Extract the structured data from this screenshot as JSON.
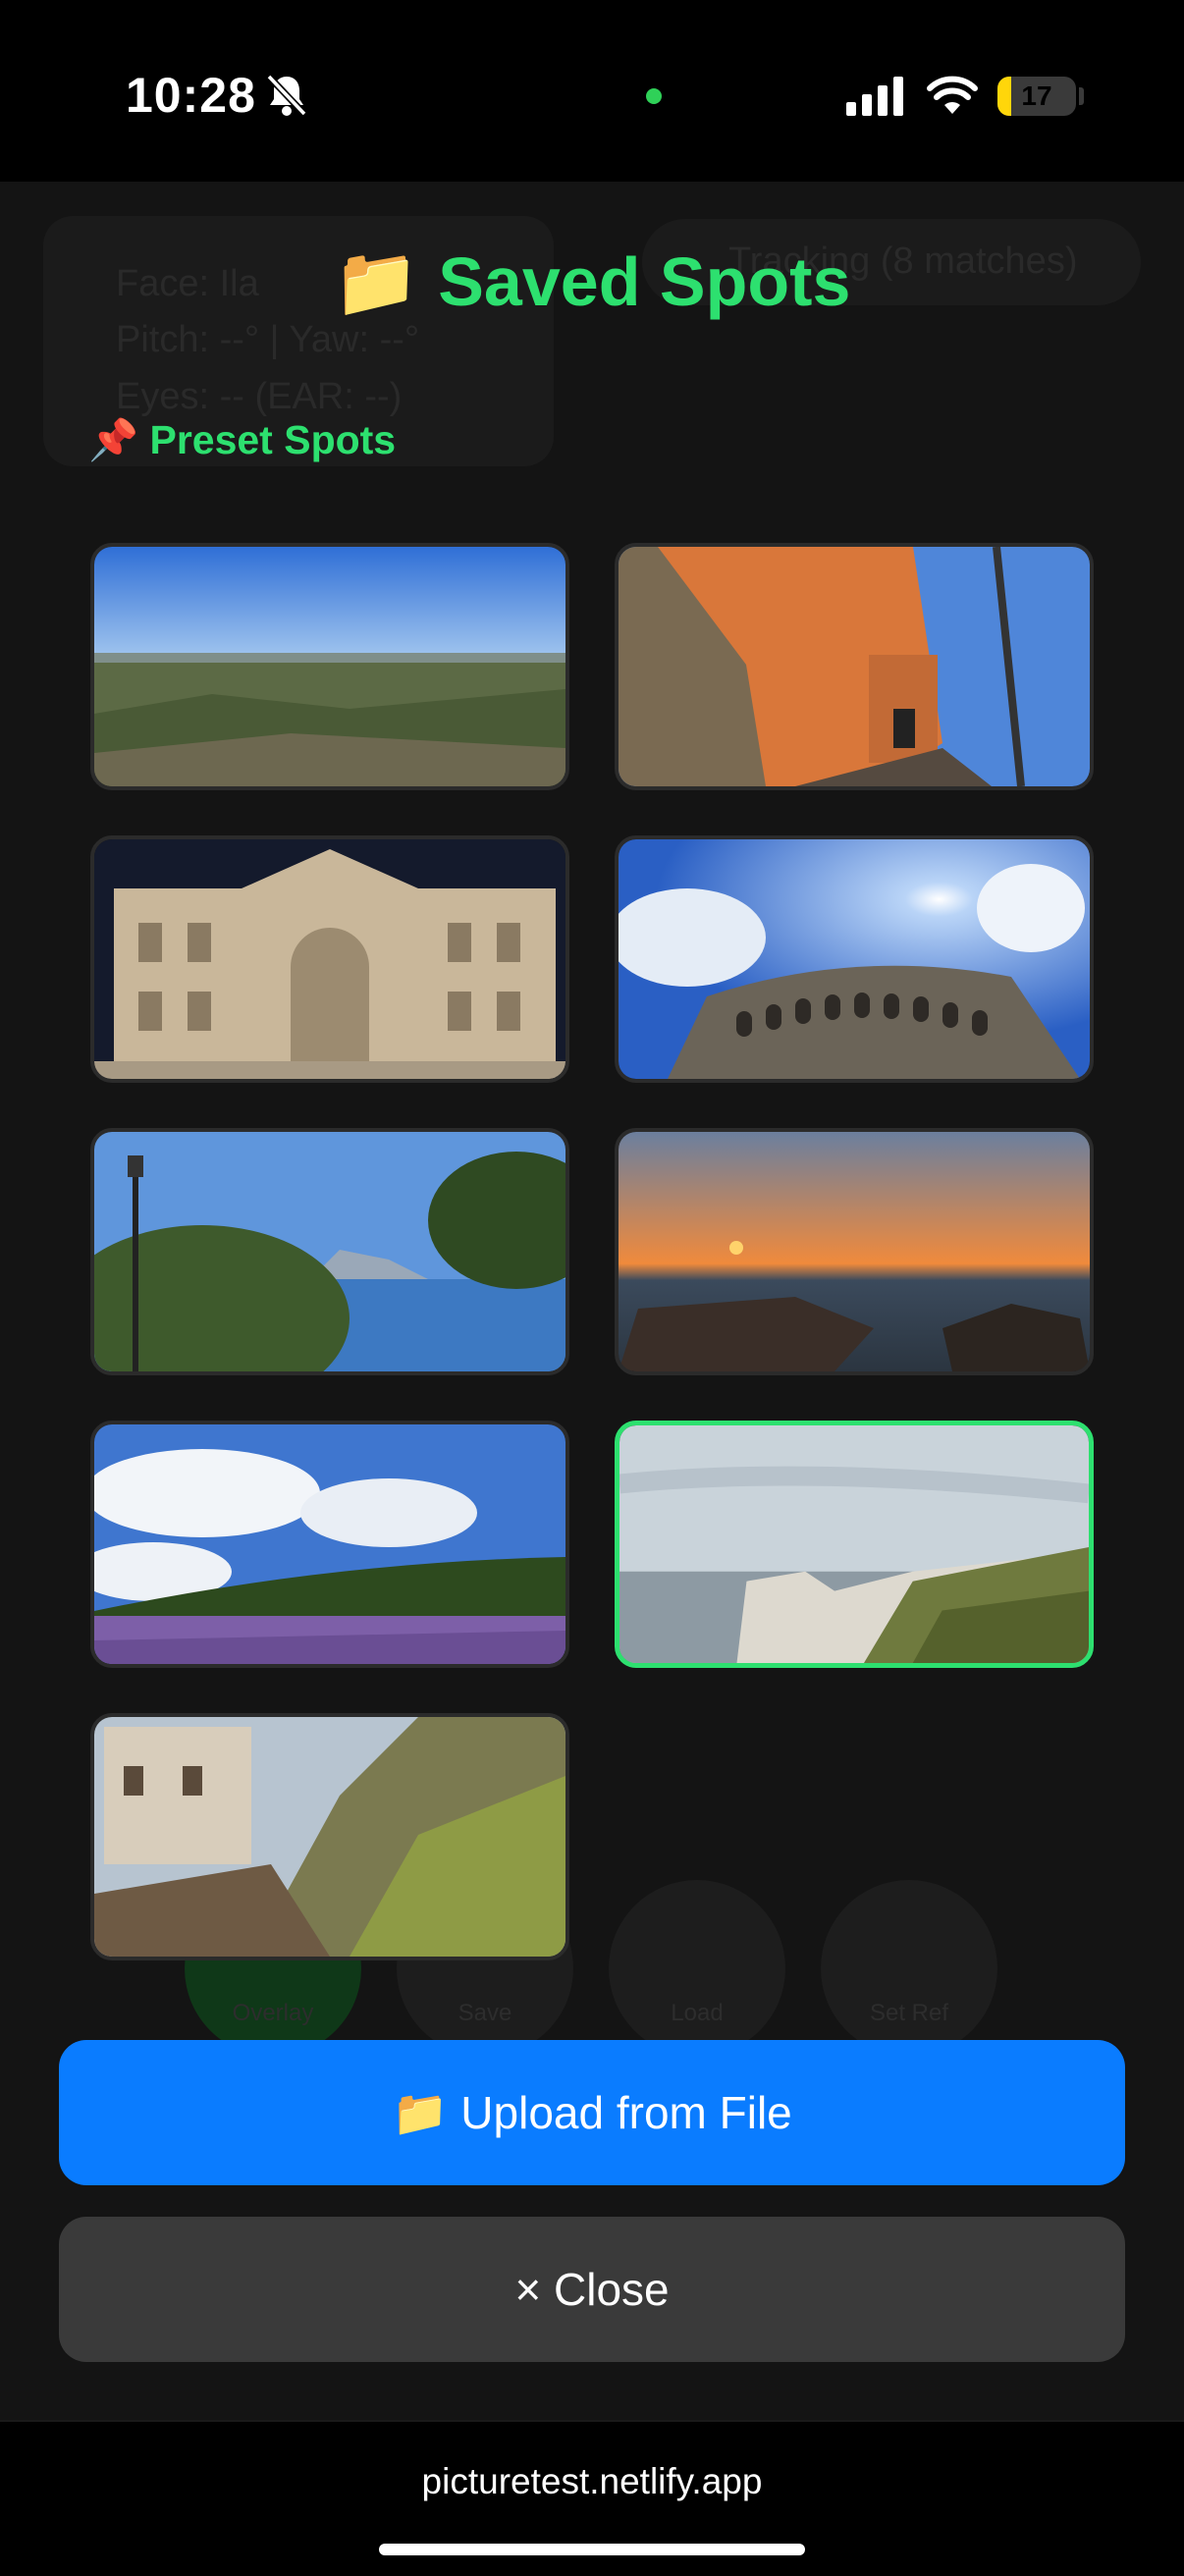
{
  "status_bar": {
    "time": "10:28",
    "battery_percent": 17,
    "icons": [
      "bell-slash-icon",
      "camera-in-use-dot",
      "cellular-signal-icon",
      "wifi-icon",
      "battery-icon"
    ]
  },
  "background_app": {
    "panel_lines": [
      "Face: Ila",
      "Pitch: --° | Yaw: --°",
      "Eyes: -- (EAR: --)"
    ],
    "tracking_pill": "Tracking (8 matches)",
    "buttons": [
      "Overlay",
      "Save",
      "Load",
      "Set Ref"
    ]
  },
  "modal": {
    "title_emoji": "📁",
    "title": "Saved Spots",
    "section_emoji": "📌",
    "section_label": "Preset Spots",
    "spots": [
      {
        "description": "coastal plain panorama",
        "selected": false
      },
      {
        "description": "cliff walkway at dusk",
        "selected": false
      },
      {
        "description": "fountain facade at night",
        "selected": false
      },
      {
        "description": "amphitheater with sun",
        "selected": false
      },
      {
        "description": "sea view with island",
        "selected": false
      },
      {
        "description": "sunset over rocky sea",
        "selected": false
      },
      {
        "description": "lavender field",
        "selected": false
      },
      {
        "description": "white sea cliffs",
        "selected": true
      },
      {
        "description": "hillside village path",
        "selected": false
      }
    ],
    "upload_emoji": "📁",
    "upload_label": "Upload from File",
    "close_label": "× Close"
  },
  "browser": {
    "url": "picturetest.netlify.app"
  },
  "colors": {
    "accent_green": "#2de06f",
    "upload_blue": "#0a7cff",
    "close_gray": "#3a3a3a",
    "battery_yellow": "#ffd60a"
  }
}
